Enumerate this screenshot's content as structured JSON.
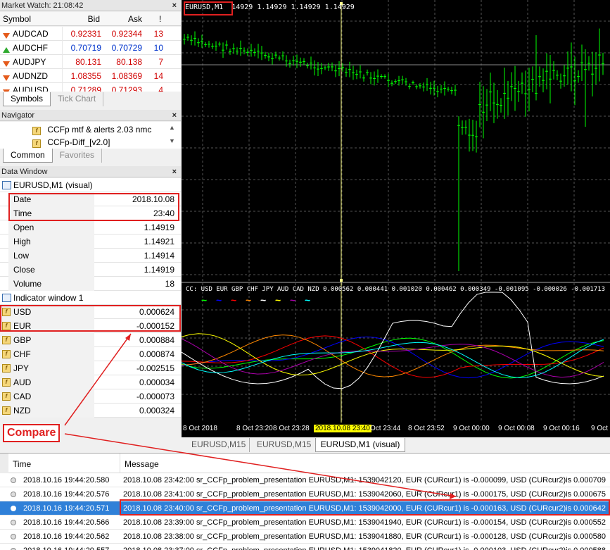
{
  "market_watch": {
    "title": "Market Watch: 21:08:42",
    "columns": [
      "Symbol",
      "Bid",
      "Ask",
      "!"
    ],
    "rows": [
      {
        "symbol": "AUDCAD",
        "bid": "0.92331",
        "ask": "0.92344",
        "spread": "13",
        "dir": "down"
      },
      {
        "symbol": "AUDCHF",
        "bid": "0.70719",
        "ask": "0.70729",
        "spread": "10",
        "dir": "up"
      },
      {
        "symbol": "AUDJPY",
        "bid": "80.131",
        "ask": "80.138",
        "spread": "7",
        "dir": "down"
      },
      {
        "symbol": "AUDNZD",
        "bid": "1.08355",
        "ask": "1.08369",
        "spread": "14",
        "dir": "down"
      },
      {
        "symbol": "AUDUSD",
        "bid": "0.71289",
        "ask": "0.71293",
        "spread": "4",
        "dir": "down"
      }
    ],
    "tabs": [
      "Symbols",
      "Tick Chart"
    ]
  },
  "navigator": {
    "title": "Navigator",
    "items": [
      "CCFp mtf & alerts 2.03 nmc",
      "CCFp-Diff_[v2.0]"
    ],
    "tabs": [
      "Common",
      "Favorites"
    ]
  },
  "data_window": {
    "title": "Data Window",
    "header": "EURUSD,M1 (visual)",
    "rows": [
      {
        "label": "Date",
        "value": "2018.10.08"
      },
      {
        "label": "Time",
        "value": "23:40"
      },
      {
        "label": "Open",
        "value": "1.14919"
      },
      {
        "label": "High",
        "value": "1.14921"
      },
      {
        "label": "Low",
        "value": "1.14914"
      },
      {
        "label": "Close",
        "value": "1.14919"
      },
      {
        "label": "Volume",
        "value": "18"
      }
    ],
    "indicator_header": "Indicator window 1",
    "indicator_rows": [
      {
        "label": "USD",
        "value": "0.000624"
      },
      {
        "label": "EUR",
        "value": "-0.000152"
      },
      {
        "label": "GBP",
        "value": "0.000884"
      },
      {
        "label": "CHF",
        "value": "0.000874"
      },
      {
        "label": "JPY",
        "value": "-0.002515"
      },
      {
        "label": "AUD",
        "value": "0.000034"
      },
      {
        "label": "CAD",
        "value": "-0.000073"
      },
      {
        "label": "NZD",
        "value": "0.000324"
      }
    ]
  },
  "annotation": {
    "compare_label": "Compare",
    "color": "#e02020"
  },
  "chart": {
    "price_label": "EURUSD,M1",
    "price_values": "14929 1.14929 1.14929 1.14929",
    "indicator_label": "CC: USD EUR GBP CHF JPY AUD CAD NZD 0.000562 0.000441 0.001020 0.000462 0.000349 -0.001095 -0.000026 -0.001713",
    "legend_colors": [
      "#00ff00",
      "#0000ff",
      "#ff0000",
      "#ff8800",
      "#ffffff",
      "#ffff00",
      "#aa00aa",
      "#00ffff"
    ],
    "time_labels": [
      "8 Oct 2018",
      "8 Oct 23:20",
      "8 Oct 23:28",
      "2018.10.08 23:40",
      "Oct 23:44",
      "8 Oct 23:52",
      "9 Oct 00:00",
      "9 Oct 00:08",
      "9 Oct 00:16",
      "9 Oct"
    ],
    "candle_color": "#00ff00",
    "background": "#000000",
    "tabs": [
      "EURUSD,M15",
      "EURUSD,M15",
      "EURUSD,M1 (visual)"
    ]
  },
  "journal": {
    "columns": [
      "Time",
      "Message"
    ],
    "rows": [
      {
        "time": "2018.10.16 19:44:20.580",
        "message": "2018.10.08 23:42:00 sr_CCFp_problem_presentation EURUSD,M1: 1539042120, EUR (CURcur1) is -0.000099, USD (CURcur2)is 0.000709"
      },
      {
        "time": "2018.10.16 19:44:20.576",
        "message": "2018.10.08 23:41:00 sr_CCFp_problem_presentation EURUSD,M1: 1539042060, EUR (CURcur1) is -0.000175, USD (CURcur2)is 0.000675"
      },
      {
        "time": "2018.10.16 19:44:20.571",
        "message": "2018.10.08 23:40:00 sr_CCFp_problem_presentation EURUSD,M1: 1539042000, EUR (CURcur1) is -0.000163, USD (CURcur2)is 0.000642"
      },
      {
        "time": "2018.10.16 19:44:20.566",
        "message": "2018.10.08 23:39:00 sr_CCFp_problem_presentation EURUSD,M1: 1539041940, EUR (CURcur1) is -0.000154, USD (CURcur2)is 0.000552"
      },
      {
        "time": "2018.10.16 19:44:20.562",
        "message": "2018.10.08 23:38:00 sr_CCFp_problem_presentation EURUSD,M1: 1539041880, EUR (CURcur1) is -0.000128, USD (CURcur2)is 0.000580"
      },
      {
        "time": "2018.10.16 19:44:20.557",
        "message": "2018.10.08 23:37:00 sr_CCFp_problem_presentation EURUSD,M1: 1539041820, EUR (CURcur1) is -0.000103, USD (CURcur2)is 0.000588"
      }
    ]
  }
}
